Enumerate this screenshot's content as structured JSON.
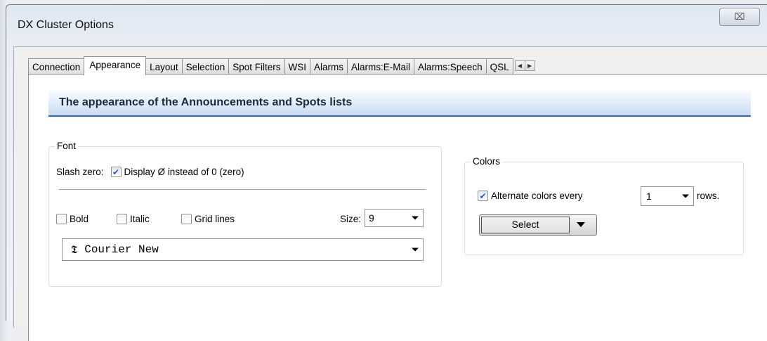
{
  "window": {
    "title": "DX Cluster Options",
    "close_glyph": "⌧"
  },
  "tabs": [
    {
      "label": "Connection"
    },
    {
      "label": "Appearance",
      "active": true
    },
    {
      "label": "Layout"
    },
    {
      "label": "Selection"
    },
    {
      "label": "Spot Filters"
    },
    {
      "label": "WSI"
    },
    {
      "label": "Alarms"
    },
    {
      "label": "Alarms:E-Mail"
    },
    {
      "label": "Alarms:Speech"
    },
    {
      "label": "QSL"
    }
  ],
  "tab_scroll": {
    "left": "◀",
    "right": "▶"
  },
  "header": {
    "title": "The appearance of the Announcements and Spots lists"
  },
  "font_group": {
    "title": "Font",
    "slash_zero_label": "Slash zero:",
    "display_slash_label": "Display Ø instead of 0 (zero)",
    "display_slash_checked": true,
    "bold_label": "Bold",
    "bold_checked": false,
    "italic_label": "Italic",
    "italic_checked": false,
    "grid_lines_label": "Grid lines",
    "grid_lines_checked": false,
    "size_label": "Size:",
    "size_value": "9",
    "font_icon": "𝕿",
    "font_value": "Courier New"
  },
  "colors_group": {
    "title": "Colors",
    "alternate_label": "Alternate colors every",
    "alternate_checked": true,
    "rows_value": "1",
    "rows_suffix": "rows.",
    "select_label": "Select"
  },
  "colors": {
    "header_underline": "#3a63a8",
    "check_color": "#2a58b0"
  }
}
